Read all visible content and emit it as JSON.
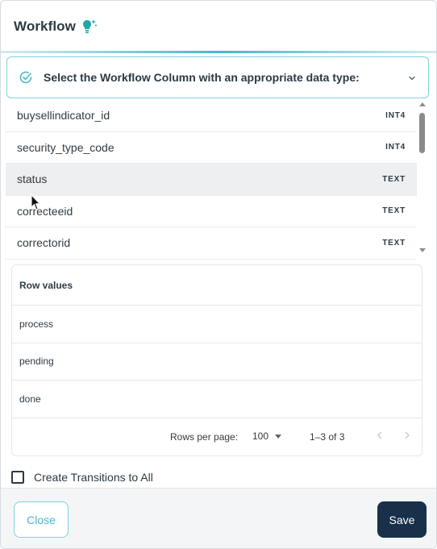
{
  "header": {
    "title": "Workflow",
    "icon": "lightbulb-sparkle-icon",
    "icon_color": "#1fa6a8"
  },
  "selector": {
    "label": "Select the Workflow Column with an appropriate data type:",
    "accent": "#7cd2e0"
  },
  "columns": [
    {
      "name": "buysellindicator_id",
      "type": "INT4"
    },
    {
      "name": "security_type_code",
      "type": "INT4"
    },
    {
      "name": "status",
      "type": "TEXT",
      "selected": true
    },
    {
      "name": "correcteeid",
      "type": "TEXT"
    },
    {
      "name": "correctorid",
      "type": "TEXT"
    }
  ],
  "row_values": {
    "header": "Row values",
    "values": [
      "process",
      "pending",
      "done"
    ]
  },
  "pagination": {
    "rows_per_page_label": "Rows per page:",
    "rows_per_page_value": "100",
    "range": "1–3 of 3"
  },
  "transitions": {
    "checkbox_label": "Create Transitions to All",
    "checked": false
  },
  "footer": {
    "close_label": "Close",
    "save_label": "Save"
  },
  "colors": {
    "save_bg": "#18304a",
    "close_text": "#4bb6cc"
  }
}
